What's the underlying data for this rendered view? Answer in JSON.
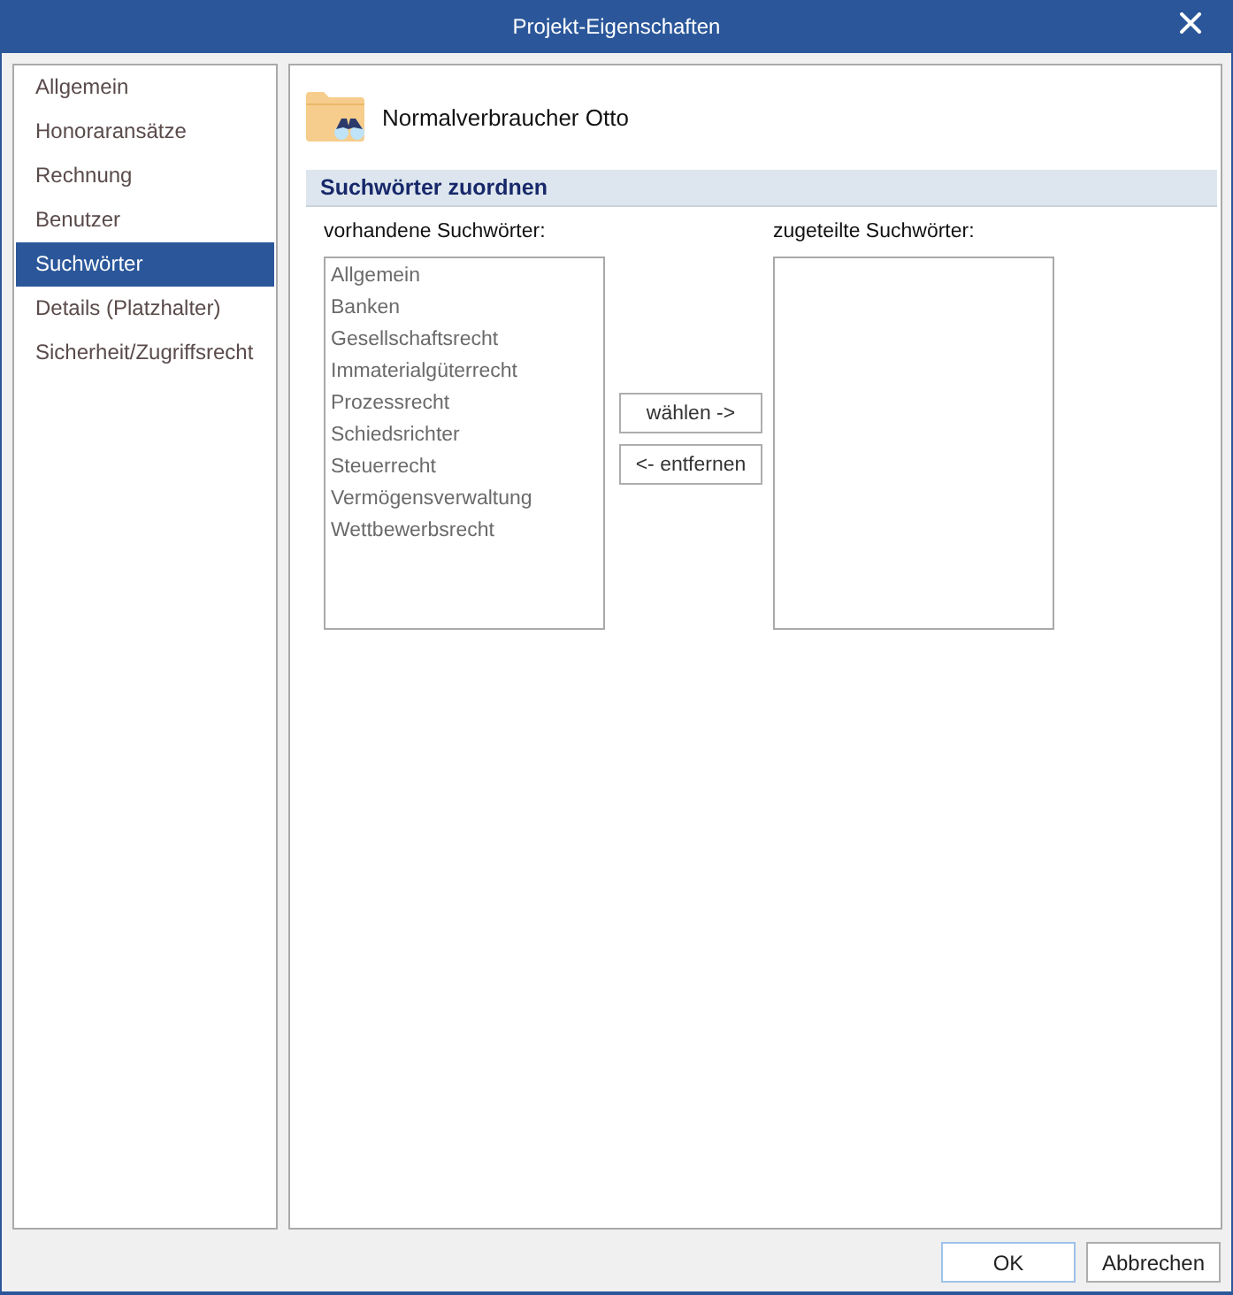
{
  "window": {
    "title": "Projekt-Eigenschaften"
  },
  "sidebar": {
    "items": [
      {
        "label": "Allgemein",
        "selected": false
      },
      {
        "label": "Honoraransätze",
        "selected": false
      },
      {
        "label": "Rechnung",
        "selected": false
      },
      {
        "label": "Benutzer",
        "selected": false
      },
      {
        "label": "Suchwörter",
        "selected": true
      },
      {
        "label": "Details (Platzhalter)",
        "selected": false
      },
      {
        "label": "Sicherheit/Zugriffsrecht",
        "selected": false
      }
    ]
  },
  "project": {
    "name": "Normalverbraucher Otto"
  },
  "section": {
    "title": "Suchwörter zuordnen"
  },
  "available": {
    "label": "vorhandene Suchwörter:",
    "items": [
      "Allgemein",
      "Banken",
      "Gesellschaftsrecht",
      "Immaterialgüterrecht",
      "Prozessrecht",
      "Schiedsrichter",
      "Steuerrecht",
      "Vermögensverwaltung",
      "Wettbewerbsrecht"
    ]
  },
  "move_buttons": [
    "wählen ->",
    "<- entfernen"
  ],
  "assigned": {
    "label": "zugeteilte Suchwörter:"
  },
  "footer_buttons": [
    {
      "label": "OK",
      "default": true
    },
    {
      "label": "Abbrechen",
      "default": false
    }
  ]
}
